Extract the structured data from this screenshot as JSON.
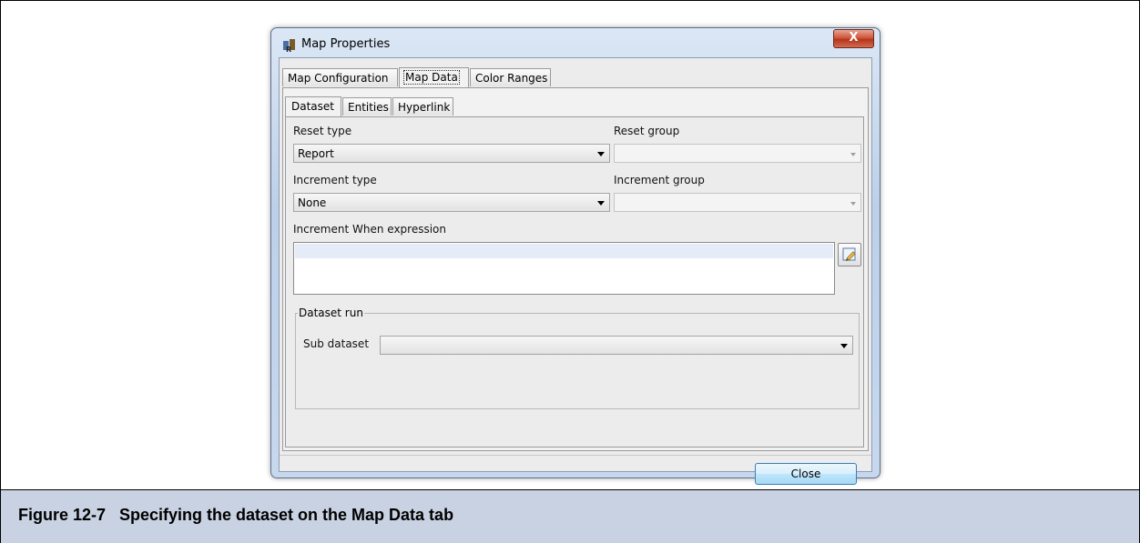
{
  "window": {
    "title": "Map Properties",
    "close_glyph": "X"
  },
  "tabs_top": [
    {
      "label": "Map Configuration",
      "active": false
    },
    {
      "label": "Map Data",
      "active": true
    },
    {
      "label": "Color Ranges",
      "active": false
    }
  ],
  "tabs_sub": [
    {
      "label": "Dataset",
      "active": true
    },
    {
      "label": "Entities",
      "active": false
    },
    {
      "label": "Hyperlink",
      "active": false
    }
  ],
  "form": {
    "reset_type_label": "Reset type",
    "reset_type_value": "Report",
    "reset_group_label": "Reset group",
    "reset_group_value": "",
    "increment_type_label": "Increment type",
    "increment_type_value": "None",
    "increment_group_label": "Increment group",
    "increment_group_value": "",
    "increment_when_label": "Increment When expression",
    "increment_when_value": "",
    "dataset_run_legend": "Dataset run",
    "sub_dataset_label": "Sub dataset",
    "sub_dataset_value": ""
  },
  "buttons": {
    "close_label": "Close"
  },
  "caption": {
    "number": "Figure 12-7",
    "title": "Specifying the dataset on the Map Data tab"
  },
  "icons": {
    "app": "map-properties-app-icon",
    "expression_editor": "pencil-edit-icon",
    "dropdown": "chevron-down-icon"
  },
  "colors": {
    "caption_bg": "#c8d2e2",
    "close_button_red": "#c9462c",
    "window_frame": "#bcd0e8"
  }
}
